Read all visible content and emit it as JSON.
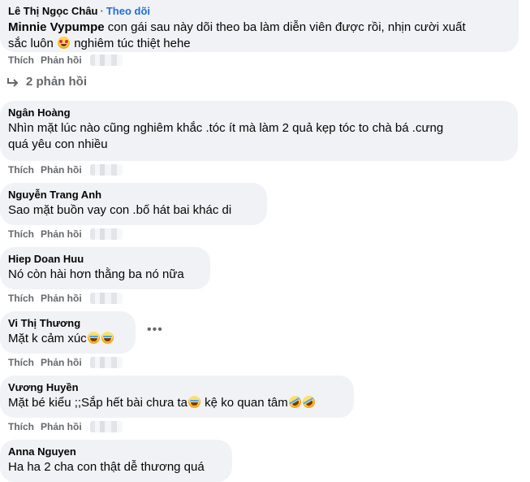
{
  "comments": [
    {
      "author": "Lê Thị Ngọc Châu",
      "follow_label": "Theo dõi",
      "mention": "Minnie Vypumpe",
      "text_line1": " con gái sau này dõi theo ba làm diễn viên được rồi, nhịn cười xuất",
      "text_line2a": "sắc luôn ",
      "text_line2b": " nghiêm túc thiệt hehe",
      "emoji": "smiling-face-with-hearts"
    },
    {
      "author": "Ngân Hoàng",
      "text_line1": "Nhìn mặt lúc nào cũng nghiêm khắc .tóc ít mà làm 2 quả kẹp tóc to chà bá .cưng",
      "text_line2": "quá yêu con nhiều"
    },
    {
      "author": "Nguyễn Trang Anh",
      "text_line1": "Sao mặt buồn vay con .bố hát bai khác di"
    },
    {
      "author": "Hiep Doan Huu",
      "text_line1": "Nó còn hài hơn thằng ba nó nữa"
    },
    {
      "author": "Vi Thị Thương",
      "text_line1": "Mặt k cảm xúc",
      "emoji": "tears-of-joy"
    },
    {
      "author": "Vương Huyền",
      "text_part1": "Mặt bé kiểu ;;Sắp hết bài chưa ta",
      "text_part2": " kệ ko quan tâm",
      "emoji": "rolling-on-floor-laughing"
    },
    {
      "author": "Anna Nguyen",
      "text_line1": "Ha ha 2 cha con thật dễ thương quá"
    }
  ],
  "actions": {
    "like": "Thích",
    "reply": "Phản hồi"
  },
  "replies_link": {
    "label": "2 phản hồi",
    "icon": "reply-arrow-icon"
  },
  "more_options": "•••"
}
